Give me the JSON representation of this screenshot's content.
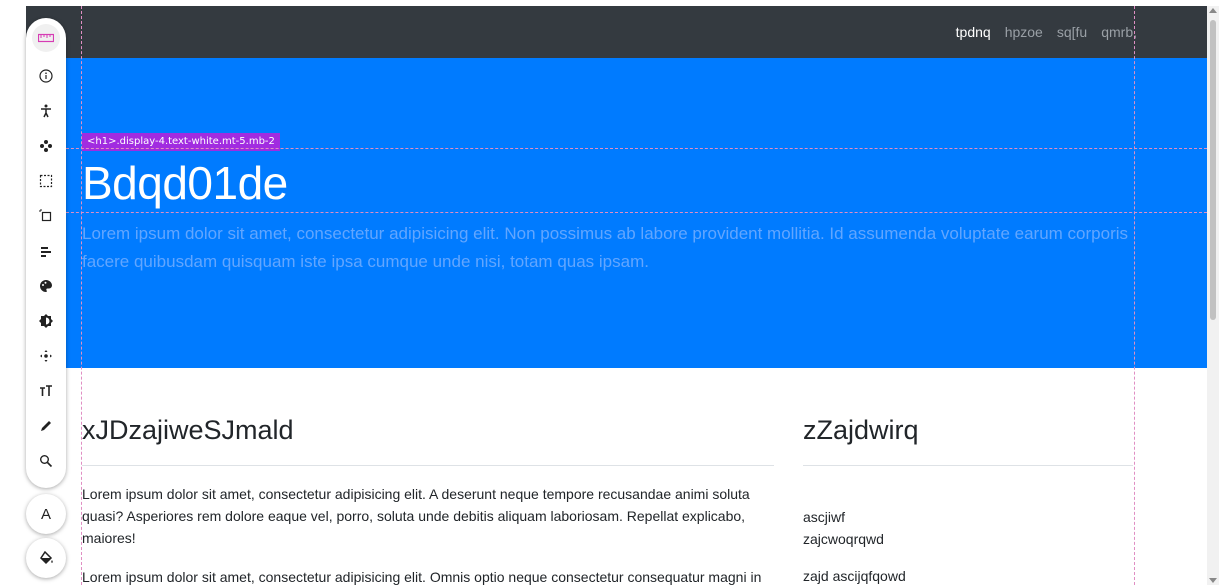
{
  "navbar": {
    "links": [
      "tpdnq",
      "hpzoe",
      "sq[fu",
      "qmrb,"
    ]
  },
  "hero": {
    "inspector_tag": "<h1>.display-4.text-white.mt-5.mb-2",
    "title": "Bdqd01de",
    "lead": "Lorem ipsum dolor sit amet, consectetur adipisicing elit. Non possimus ab labore provident mollitia. Id assumenda voluptate earum corporis facere quibusdam quisquam iste ipsa cumque unde nisi, totam quas ipsam."
  },
  "main": {
    "heading": "xJDzajiweSJmald",
    "paragraphs": [
      "Lorem ipsum dolor sit amet, consectetur adipisicing elit. A deserunt neque tempore recusandae animi soluta quasi? Asperiores rem dolore eaque vel, porro, soluta unde debitis aliquam laboriosam. Repellat explicabo, maiores!",
      "Lorem ipsum dolor sit amet, consectetur adipisicing elit. Omnis optio neque consectetur consequatur magni in"
    ]
  },
  "sidebar": {
    "heading": "zZajdwirq",
    "links": [
      "ascjiwf",
      "zajcwoqrqwd",
      "zajd ascijqfqowd"
    ]
  },
  "toolbar": {
    "tools": [
      "ruler-icon",
      "info-icon",
      "accessibility-icon",
      "move-arrows-icon",
      "select-box-icon",
      "element-box-icon",
      "align-icon",
      "palette-icon",
      "contrast-icon",
      "position-icon",
      "text-size-icon",
      "pen-icon",
      "search-icon"
    ],
    "round_buttons": [
      {
        "icon": "font-icon",
        "label": "A"
      },
      {
        "icon": "fill-bucket-icon",
        "label": ""
      }
    ]
  },
  "colors": {
    "navbar": "#343a40",
    "hero": "#007bff",
    "inspector_tag": "#a12ce0",
    "guides": "#e08ec3"
  }
}
